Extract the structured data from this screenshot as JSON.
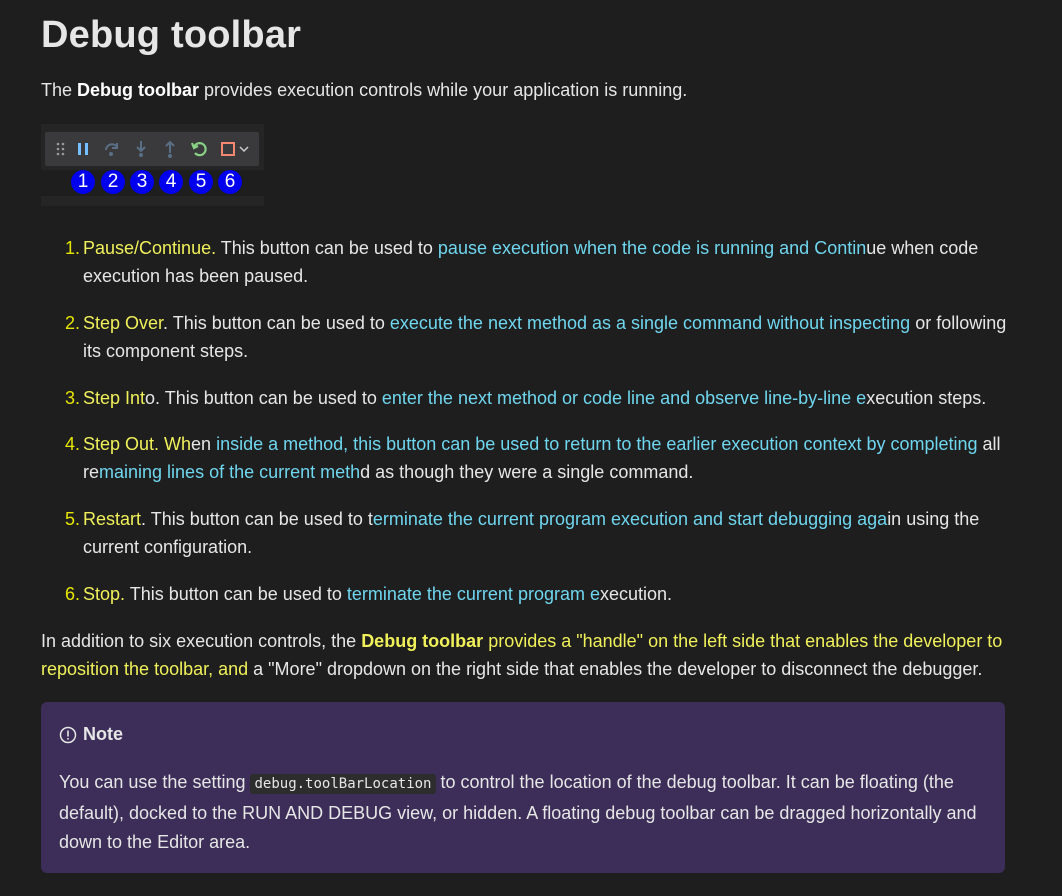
{
  "title": "Debug toolbar",
  "intro": {
    "pre": "The ",
    "bold": "Debug toolbar",
    "post": " provides execution controls while your application is running."
  },
  "toolbar_badges": [
    "1",
    "2",
    "3",
    "4",
    "5",
    "6"
  ],
  "steps": [
    {
      "num": "1.",
      "a": "Pause/Continue.",
      "b": " This button can be used to ",
      "c": "pause execution when the code is running and Contin",
      "d": "ue when code execution has been paused."
    },
    {
      "num": "2.",
      "a": "Step Over",
      "b": ". This button can be used to ",
      "c": "execute the next method as a single command without inspecting",
      "d": " or following its component steps."
    },
    {
      "num": "3.",
      "a": "Step Int",
      "b": "o. This button can be used to ",
      "c": "enter the next method or code line and observe line-by-line e",
      "d": "xecution steps."
    },
    {
      "num": "4.",
      "a": "Step Out. Wh",
      "b": "en ",
      "c": "inside a method, this button can be used to return to the earlier execution context by completing",
      "d": " all remaining lines of the current method as though they were a single command.",
      "split_c2": "maining lines of the current meth",
      "split_pre": "re",
      "split_post": "d as though they were a single command."
    },
    {
      "num": "5.",
      "a": "Restart",
      "b": ". This button can be used to t",
      "c": "erminate the current program execution and start debugging aga",
      "d": "in using the current configuration."
    },
    {
      "num": "6.",
      "a": "Stop.",
      "b": " This button can be used to ",
      "c": "terminate the current program e",
      "d": "xecution."
    }
  ],
  "para": {
    "p1": "In addition to six execution controls, the ",
    "bold": "Debug toolbar",
    "p2": " provides a \"handle\" on the left side that enables the developer to reposition the toolbar, and",
    "p3": " a \"More\" dropdown on the right side that enables the developer to disconnect the debugger."
  },
  "note": {
    "title": "Note",
    "pre": "You can use the setting ",
    "code": "debug.toolBarLocation",
    "post": " to control the location of the debug toolbar. It can be floating (the default), docked to the RUN AND DEBUG view, or hidden. A floating debug toolbar can be dragged horizontally and down to the Editor area."
  }
}
